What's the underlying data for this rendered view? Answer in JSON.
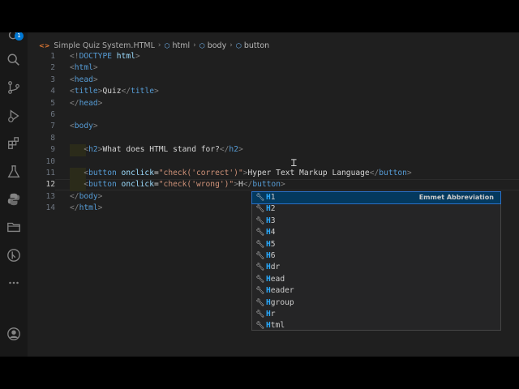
{
  "activity_bar": {
    "badge": "1",
    "icons": [
      "accounts-icon",
      "search-icon",
      "source-control-icon",
      "run-debug-icon",
      "extensions-icon",
      "testing-icon",
      "python-icon",
      "folder-icon",
      "git-graph-icon",
      "more-icon",
      "account-icon"
    ]
  },
  "breadcrumb": {
    "file": "Simple Quiz System.HTML",
    "items": [
      "html",
      "body",
      "button"
    ]
  },
  "editor": {
    "line_numbers": [
      "1",
      "2",
      "3",
      "4",
      "5",
      "6",
      "7",
      "8",
      "9",
      "10",
      "11",
      "12",
      "13",
      "14"
    ],
    "active_line": "12",
    "code": {
      "l1": {
        "p1": "<!",
        "tag": "DOCTYPE",
        "attr": "html",
        "p2": ">"
      },
      "l2": {
        "o": "<",
        "tag": "html",
        "c": ">"
      },
      "l3": {
        "o": "<",
        "tag": "head",
        "c": ">"
      },
      "l4": {
        "o": "<",
        "tag": "title",
        "c": ">",
        "text": "Quiz",
        "o2": "</",
        "tag2": "title",
        "c2": ">"
      },
      "l5": {
        "o": "</",
        "tag": "head",
        "c": ">"
      },
      "l7": {
        "o": "<",
        "tag": "body",
        "c": ">"
      },
      "l9": {
        "o": "<",
        "tag": "h2",
        "c": ">",
        "text": "What does HTML stand for?",
        "o2": "</",
        "tag2": "h2",
        "c2": ">"
      },
      "l11": {
        "o": "<",
        "tag": "button",
        "attr": " onclick",
        "eq": "=",
        "val": "\"check('correct')\"",
        "c": ">",
        "text": "Hyper Text Markup Language",
        "o2": "</",
        "tag2": "button",
        "c2": ">"
      },
      "l12": {
        "o": "<",
        "tag": "button",
        "attr": " onclick",
        "eq": "=",
        "val": "\"check('wrong')\"",
        "c": ">",
        "text": "H",
        "o2": "</",
        "tag2": "button",
        "c2": ">"
      },
      "l13": {
        "o": "</",
        "tag": "body",
        "c": ">"
      },
      "l14": {
        "o": "</",
        "tag": "html",
        "c": ">"
      }
    }
  },
  "suggestions": {
    "detail": "Emmet Abbreviation",
    "items": [
      {
        "m": "H",
        "rest": "1"
      },
      {
        "m": "H",
        "rest": "2"
      },
      {
        "m": "H",
        "rest": "3"
      },
      {
        "m": "H",
        "rest": "4"
      },
      {
        "m": "H",
        "rest": "5"
      },
      {
        "m": "H",
        "rest": "6"
      },
      {
        "m": "H",
        "rest": "dr"
      },
      {
        "m": "H",
        "rest": "ead"
      },
      {
        "m": "H",
        "rest": "eader"
      },
      {
        "m": "H",
        "rest": "group"
      },
      {
        "m": "H",
        "rest": "r"
      },
      {
        "m": "H",
        "rest": "tml"
      }
    ]
  },
  "colors": {
    "tag": "#569cd6",
    "attribute": "#9cdcfe",
    "string": "#ce9178",
    "punct": "#808080",
    "match": "#2aaaff"
  }
}
